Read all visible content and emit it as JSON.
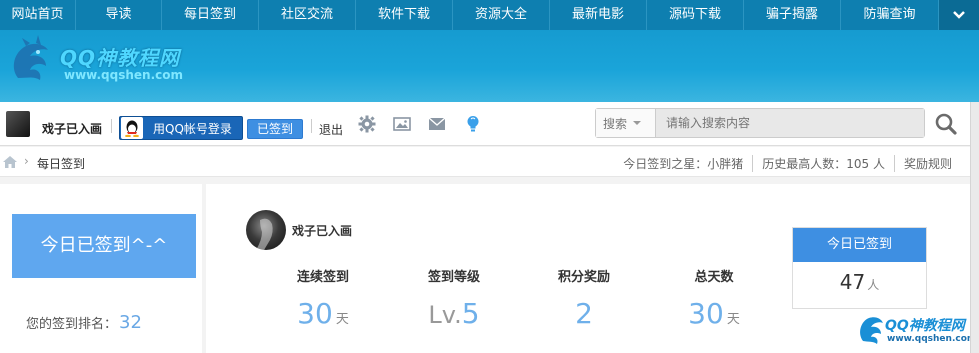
{
  "nav": {
    "items": [
      {
        "label": "网站首页"
      },
      {
        "label": "导读"
      },
      {
        "label": "每日签到"
      },
      {
        "label": "社区交流"
      },
      {
        "label": "软件下载"
      },
      {
        "label": "资源大全"
      },
      {
        "label": "最新电影"
      },
      {
        "label": "源码下载"
      },
      {
        "label": "骗子揭露"
      },
      {
        "label": "防骗查询"
      }
    ],
    "more_icon": "chevron-down-icon"
  },
  "banner": {
    "brand_title": "QQ神教程网",
    "brand_url": "www.qqshen.com",
    "colors": {
      "bg": "#169bd0"
    }
  },
  "toolbar": {
    "username": "戏子已入画",
    "qq_login_label": "用QQ帐号登录",
    "signed_label": "已签到",
    "logout_label": "退出",
    "icons": [
      "gear-icon",
      "image-icon",
      "mail-icon",
      "lightbulb-icon"
    ],
    "search": {
      "type_label": "搜索",
      "placeholder": "请输入搜索内容"
    }
  },
  "breadcrumb": {
    "current": "每日签到"
  },
  "stats": {
    "star": "今日签到之星：小胖猪",
    "record": "历史最高人数：105 人",
    "rules": "奖励规则"
  },
  "left": {
    "today_label": "今日已签到^-^",
    "rank_label": "您的签到排名：",
    "rank_value": "32"
  },
  "main": {
    "name": "戏子已入画",
    "columns": [
      {
        "label": "连续签到",
        "value": "30",
        "unit": "天"
      },
      {
        "label": "签到等级",
        "prefix": "Lv.",
        "value": "5"
      },
      {
        "label": "积分奖励",
        "value": "2"
      },
      {
        "label": "总天数",
        "value": "30",
        "unit": "天"
      }
    ],
    "today_card": {
      "title": "今日已签到",
      "count": "47",
      "unit": "人"
    }
  },
  "watermark": {
    "title": "QQ神教程网",
    "url": "www.qqshen.com"
  },
  "colors": {
    "accent": "#3e8fe2",
    "nav": "#0e7fb0",
    "value": "#6fb0ea"
  }
}
